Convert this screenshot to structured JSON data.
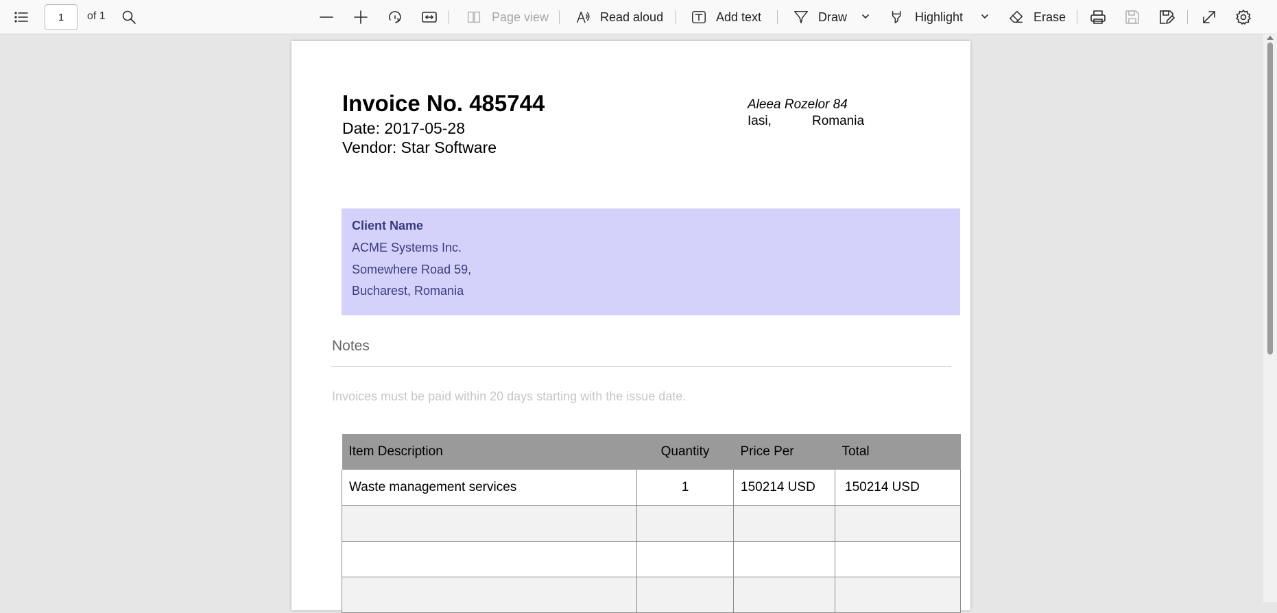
{
  "toolbar": {
    "contents_icon": "list-icon",
    "page_number": "1",
    "page_of": "of 1",
    "search_icon": "search-icon",
    "page_view_label": "Page view",
    "read_aloud_label": "Read aloud",
    "add_text_label": "Add text",
    "draw_label": "Draw",
    "highlight_label": "Highlight",
    "erase_label": "Erase"
  },
  "invoice": {
    "title": "Invoice No. 485744",
    "date": "Date: 2017-05-28",
    "vendor": "Vendor: Star Software",
    "address_line": "Aleea Rozelor 84",
    "address_city": "Iasi,",
    "address_country": "Romania"
  },
  "client": {
    "heading": "Client Name",
    "name": "ACME Systems Inc.",
    "street": "Somewhere Road 59,",
    "city": "Bucharest, Romania",
    "background_color": "#d4d2fb"
  },
  "notes": {
    "heading": "Notes",
    "text": "Invoices must be paid within 20 days starting with the issue date."
  },
  "items_table": {
    "headers": [
      "Item Description",
      "Quantity",
      "Price Per",
      "Total"
    ],
    "rows": [
      [
        "Waste management services",
        "1",
        "150214 USD",
        "150214 USD"
      ],
      [
        "",
        "",
        "",
        ""
      ],
      [
        "",
        "",
        "",
        ""
      ],
      [
        "",
        "",
        "",
        ""
      ]
    ],
    "header_color": "#9a9a9a"
  }
}
